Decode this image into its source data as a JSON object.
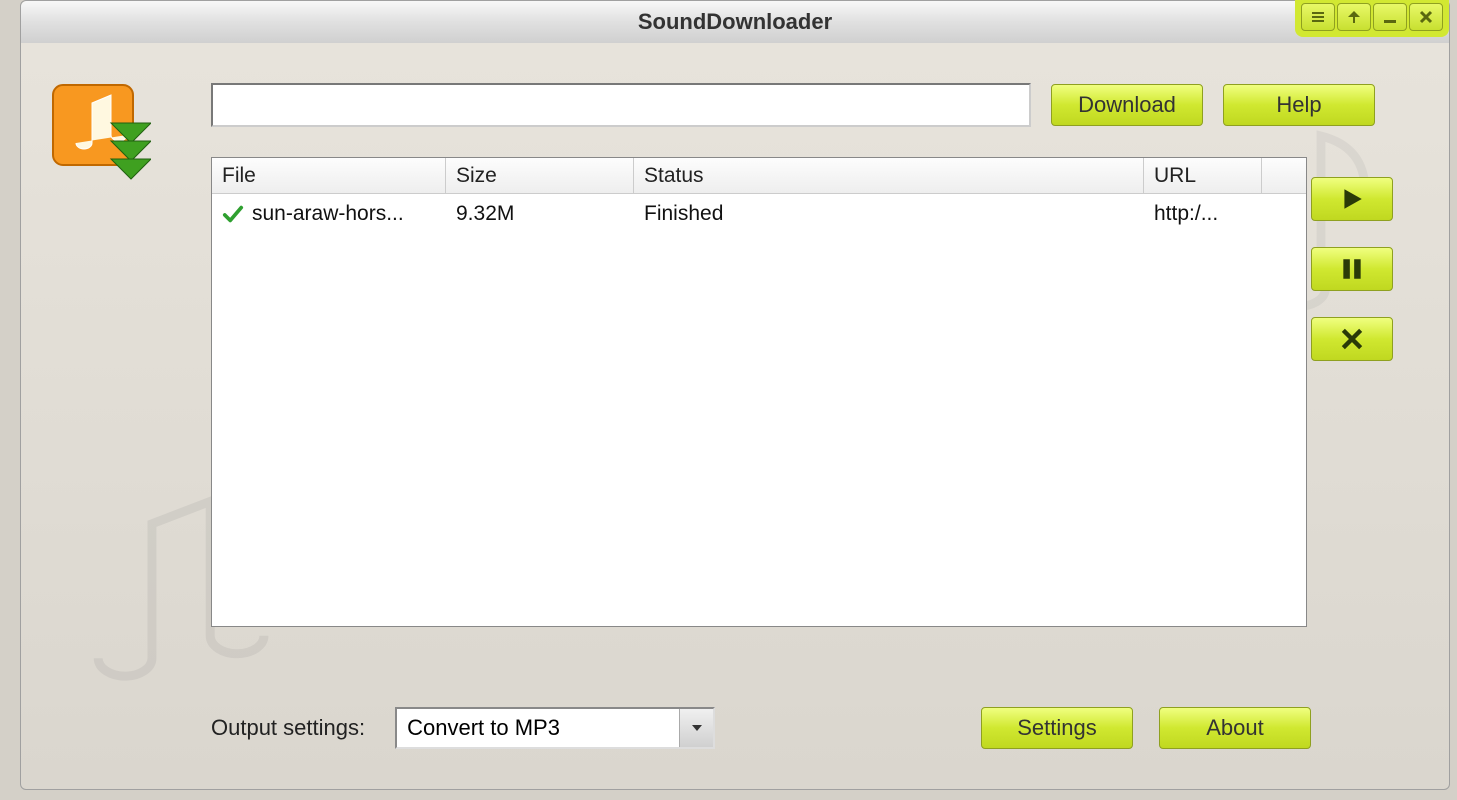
{
  "window": {
    "title": "SoundDownloader"
  },
  "toolbar": {
    "url_value": "",
    "download_label": "Download",
    "help_label": "Help"
  },
  "table": {
    "headers": {
      "file": "File",
      "size": "Size",
      "status": "Status",
      "url": "URL"
    },
    "rows": [
      {
        "file": "sun-araw-hors...",
        "size": "9.32M",
        "status": "Finished",
        "url": "http:/..."
      }
    ]
  },
  "output": {
    "label": "Output settings:",
    "selected": "Convert to MP3"
  },
  "bottom_buttons": {
    "settings": "Settings",
    "about": "About"
  }
}
